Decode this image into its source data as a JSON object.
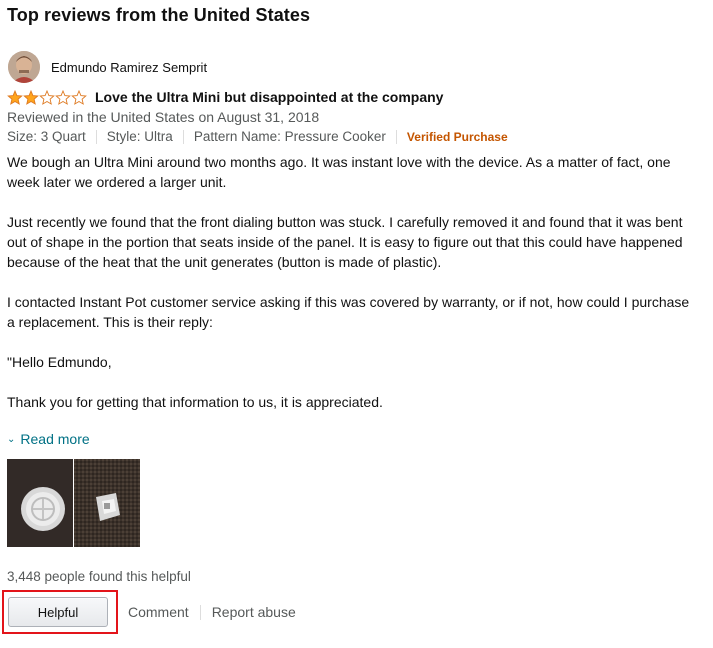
{
  "section": {
    "title": "Top reviews from the United States"
  },
  "review": {
    "author": "Edmundo Ramirez Semprit",
    "rating": 2,
    "rating_max": 5,
    "star_icon": "star-icon",
    "title": "Love the Ultra Mini but disappointed at the company",
    "date": "Reviewed in the United States on August 31, 2018",
    "variant": {
      "size": "Size: 3 Quart",
      "style": "Style: Ultra",
      "pattern": "Pattern Name: Pressure Cooker",
      "verified": "Verified Purchase"
    },
    "body": [
      "We bough an Ultra Mini around two months ago. It was instant love with the device. As a matter of fact, one week later we ordered a larger unit.",
      "Just recently we found that the front dialing button was stuck. I carefully removed it and found that it was bent out of shape in the portion that seats inside of the panel. It is easy to figure out that this could have happened because of the heat that the unit generates (button is made of plastic).",
      "I contacted Instant Pot customer service asking if this was covered by warranty, or if not, how could I purchase a replacement. This is their reply:",
      "\"Hello Edmundo,",
      "Thank you for getting that information to us, it is appreciated."
    ],
    "read_more": "Read more",
    "helpful_count": "3,448 people found this helpful"
  },
  "actions": {
    "helpful": "Helpful",
    "comment": "Comment",
    "report": "Report abuse"
  },
  "colors": {
    "star_fill": "#ffa41c",
    "link": "#007185",
    "verified": "#c45500",
    "highlight": "#e3141a",
    "muted": "#565959"
  }
}
